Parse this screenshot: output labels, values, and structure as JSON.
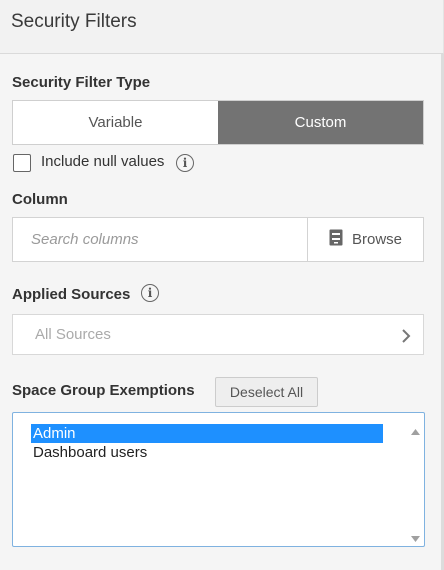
{
  "header": {
    "title": "Security Filters"
  },
  "filter_type": {
    "label": "Security Filter Type",
    "options": [
      {
        "label": "Variable",
        "active": false
      },
      {
        "label": "Custom",
        "active": true
      }
    ]
  },
  "include_null": {
    "label": "Include null values",
    "checked": false
  },
  "column": {
    "label": "Column",
    "placeholder": "Search columns",
    "browse_label": "Browse"
  },
  "applied_sources": {
    "label": "Applied Sources",
    "placeholder": "All Sources"
  },
  "exemptions": {
    "label": "Space Group Exemptions",
    "deselect_label": "Deselect All",
    "items": [
      {
        "label": "Admin",
        "selected": true
      },
      {
        "label": "Dashboard users",
        "selected": false
      }
    ]
  },
  "colors": {
    "active_segment": "#737373",
    "selection": "#1e90ff",
    "listbox_border": "#7fb2e0"
  },
  "icons": [
    "info-icon",
    "browse-icon",
    "chevron-right-icon",
    "scroll-up-icon",
    "scroll-down-icon"
  ]
}
